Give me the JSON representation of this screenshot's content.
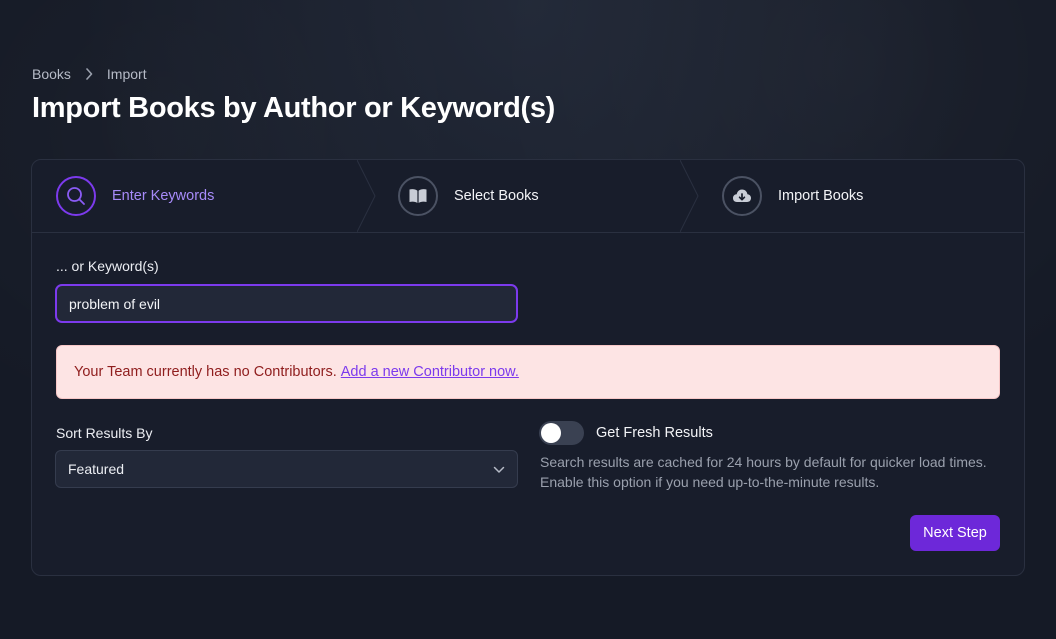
{
  "breadcrumb": {
    "items": [
      "Books",
      "Import"
    ]
  },
  "page": {
    "title": "Import Books by Author or Keyword(s)"
  },
  "steps": [
    {
      "label": "Enter Keywords",
      "icon": "search-icon",
      "state": "active"
    },
    {
      "label": "Select Books",
      "icon": "book-open-icon",
      "state": "upcoming"
    },
    {
      "label": "Import Books",
      "icon": "cloud-download-icon",
      "state": "upcoming"
    }
  ],
  "keywords": {
    "label": "... or Keyword(s)",
    "value": "problem of evil"
  },
  "alert": {
    "message": "Your Team currently has no Contributors.",
    "link_text": "Add a new Contributor now."
  },
  "sort": {
    "label": "Sort Results By",
    "selected": "Featured"
  },
  "fresh_results": {
    "label": "Get Fresh Results",
    "enabled": false,
    "help": "Search results are cached for 24 hours by default for quicker load times. Enable this option if you need up-to-the-minute results."
  },
  "actions": {
    "next_label": "Next Step"
  },
  "colors": {
    "accent": "#7c3aed",
    "button": "#6d28d9",
    "alert_bg": "#fde4e4",
    "alert_text": "#8f1d1d"
  }
}
